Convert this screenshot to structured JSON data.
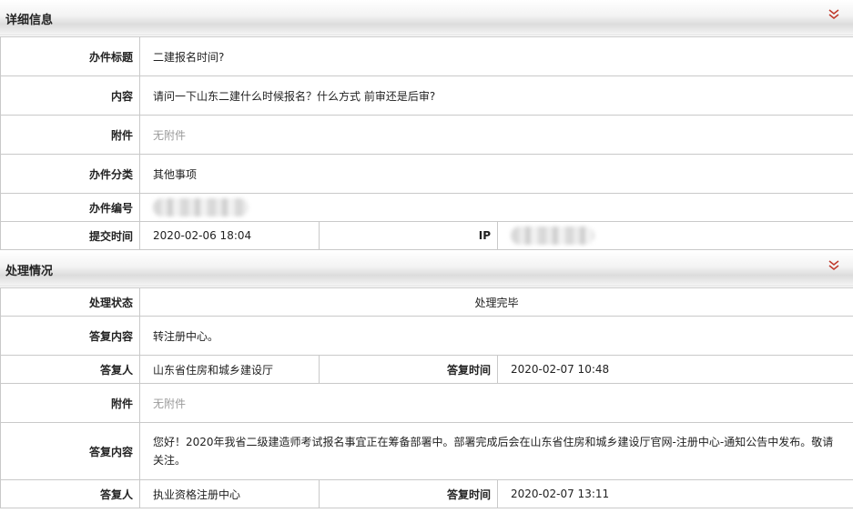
{
  "detail": {
    "title": "详细信息",
    "rows": {
      "subject_label": "办件标题",
      "subject_value": "二建报名时间?",
      "content_label": "内容",
      "content_value": "请问一下山东二建什么时候报名？什么方式 前审还是后审?",
      "attachment_label": "附件",
      "attachment_value": "无附件",
      "category_label": "办件分类",
      "category_value": "其他事项",
      "number_label": "办件编号",
      "submit_time_label": "提交时间",
      "submit_time_value": "2020-02-06 18:04",
      "ip_label": "IP"
    }
  },
  "handling": {
    "title": "处理情况",
    "rows": {
      "status_label": "处理状态",
      "status_value": "处理完毕",
      "reply1_label": "答复内容",
      "reply1_value": "转注册中心。",
      "responder1_label": "答复人",
      "responder1_value": "山东省住房和城乡建设厅",
      "reply_time1_label": "答复时间",
      "reply_time1_value": "2020-02-07 10:48",
      "attachment_label": "附件",
      "attachment_value": "无附件",
      "reply2_label": "答复内容",
      "reply2_value": "您好！2020年我省二级建造师考试报名事宜正在筹备部署中。部署完成后会在山东省住房和城乡建设厅官网-注册中心-通知公告中发布。敬请关注。",
      "responder2_label": "答复人",
      "responder2_value": "执业资格注册中心",
      "reply_time2_label": "答复时间",
      "reply_time2_value": "2020-02-07 13:11"
    }
  },
  "colors": {
    "toggle_icon": "#c0392b",
    "border": "#c9c9c9",
    "muted_text": "#9a9a9a"
  },
  "icons": {
    "toggle": "double-chevron-down-icon"
  }
}
